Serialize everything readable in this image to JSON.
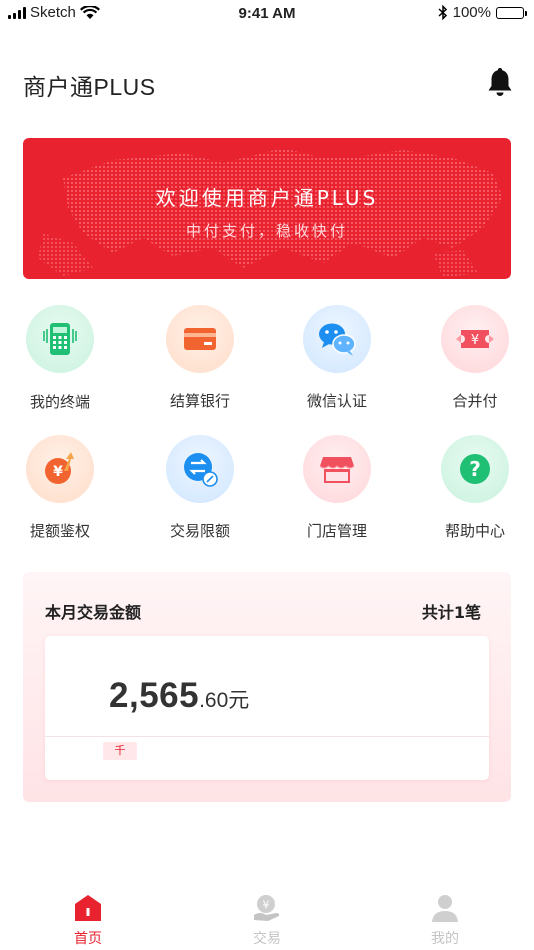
{
  "status_bar": {
    "carrier": "Sketch",
    "time": "9:41 AM",
    "battery": "100%"
  },
  "header": {
    "title": "商户通PLUS"
  },
  "banner": {
    "title": "欢迎使用商户通PLUS",
    "subtitle": "中付支付，稳收快付"
  },
  "grid": [
    {
      "label": "我的终端",
      "icon": "pos-terminal-icon"
    },
    {
      "label": "结算银行",
      "icon": "bank-card-icon"
    },
    {
      "label": "微信认证",
      "icon": "wechat-icon"
    },
    {
      "label": "合并付",
      "icon": "merge-pay-icon"
    },
    {
      "label": "提额鉴权",
      "icon": "limit-raise-icon"
    },
    {
      "label": "交易限额",
      "icon": "transaction-limit-icon"
    },
    {
      "label": "门店管理",
      "icon": "store-icon"
    },
    {
      "label": "帮助中心",
      "icon": "help-icon"
    }
  ],
  "summary": {
    "title": "本月交易金额",
    "count": "共计1笔",
    "amount_main": "2,565",
    "amount_decimal": ".60元",
    "unit_tag": "千"
  },
  "tabbar": [
    {
      "label": "首页",
      "active": true,
      "icon": "home-icon"
    },
    {
      "label": "交易",
      "active": false,
      "icon": "transaction-icon"
    },
    {
      "label": "我的",
      "active": false,
      "icon": "user-icon"
    }
  ],
  "colors": {
    "brand": "#e8222e",
    "inactive": "#c4c4c4"
  }
}
